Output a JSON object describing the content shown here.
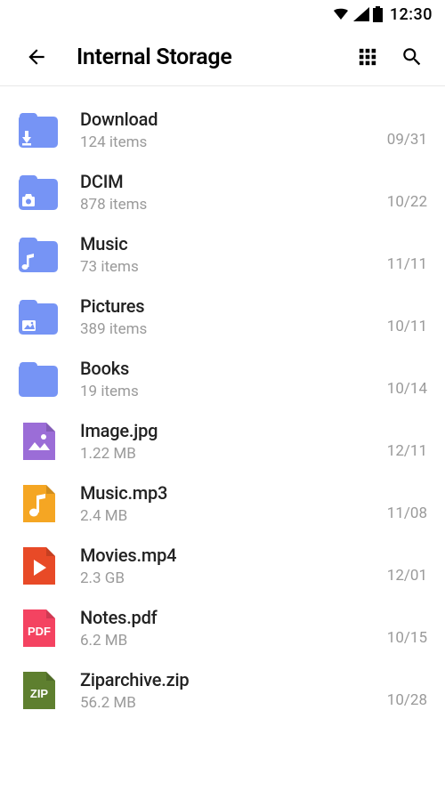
{
  "status": {
    "time": "12:30"
  },
  "header": {
    "title": "Internal Storage"
  },
  "items": [
    {
      "name": "Download",
      "sub": "124 items",
      "date": "09/31",
      "icon": "folder-download"
    },
    {
      "name": "DCIM",
      "sub": "878 items",
      "date": "10/22",
      "icon": "folder-camera"
    },
    {
      "name": "Music",
      "sub": "73 items",
      "date": "11/11",
      "icon": "folder-music"
    },
    {
      "name": "Pictures",
      "sub": "389 items",
      "date": "10/11",
      "icon": "folder-picture"
    },
    {
      "name": "Books",
      "sub": "19 items",
      "date": "10/14",
      "icon": "folder-plain"
    },
    {
      "name": "Image.jpg",
      "sub": "1.22 MB",
      "date": "12/11",
      "icon": "file-image"
    },
    {
      "name": "Music.mp3",
      "sub": "2.4 MB",
      "date": "11/08",
      "icon": "file-audio"
    },
    {
      "name": "Movies.mp4",
      "sub": "2.3 GB",
      "date": "12/01",
      "icon": "file-video"
    },
    {
      "name": "Notes.pdf",
      "sub": "6.2 MB",
      "date": "10/15",
      "icon": "file-pdf"
    },
    {
      "name": "Ziparchive.zip",
      "sub": "56.2 MB",
      "date": "10/28",
      "icon": "file-zip"
    }
  ],
  "colors": {
    "folder": "#7694f5",
    "image": "#9b6dd7",
    "audio": "#f5a623",
    "video": "#e84a27",
    "pdf": "#f44361",
    "zip": "#5e7f2f"
  }
}
